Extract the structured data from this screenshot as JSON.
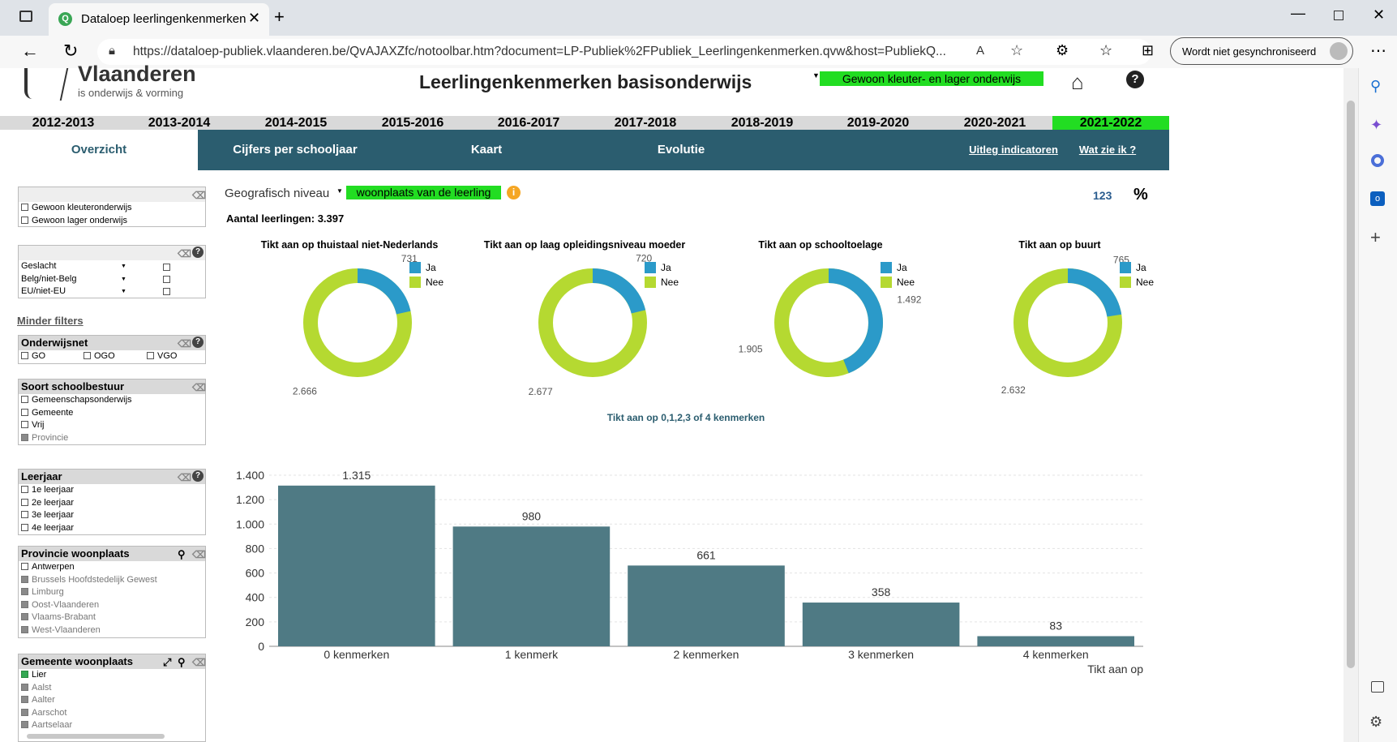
{
  "browser": {
    "tab_title": "Dataloep leerlingenkenmerken",
    "url": "https://dataloep-publiek.vlaanderen.be/QvAJAXZfc/notoolbar.htm?document=LP-Publiek%2FPubliek_Leerlingenkenmerken.qvw&host=PubliekQ...",
    "profile_label": "Wordt niet gesynchroniseerd"
  },
  "logo": {
    "name": "Vlaanderen",
    "tagline": "is onderwijs & vorming"
  },
  "header": {
    "title": "Leerlingenkenmerken basisonderwijs",
    "selector_value": "Gewoon kleuter- en lager onderwijs"
  },
  "years": [
    "2012-2013",
    "2013-2014",
    "2014-2015",
    "2015-2016",
    "2016-2017",
    "2017-2018",
    "2018-2019",
    "2019-2020",
    "2020-2021",
    "2021-2022"
  ],
  "selected_year": "2021-2022",
  "nav": {
    "overview": "Overzicht",
    "per_year": "Cijfers per schooljaar",
    "map": "Kaart",
    "evolution": "Evolutie",
    "explain": "Uitleg indicatoren",
    "what": "Wat zie ik ?"
  },
  "filters": {
    "onderwijs": [
      "Gewoon kleuteronderwijs",
      "Gewoon lager onderwijs"
    ],
    "dropdowns": [
      "Geslacht",
      "Belg/niet-Belg",
      "EU/niet-EU"
    ],
    "fewer_filters": "Minder filters",
    "onderwijsnet": {
      "title": "Onderwijsnet",
      "items": [
        "GO",
        "OGO",
        "VGO"
      ]
    },
    "schoolbestuur": {
      "title": "Soort schoolbestuur",
      "items": [
        "Gemeenschapsonderwijs",
        "Gemeente",
        "Vrij",
        "Provincie"
      ]
    },
    "leerjaar": {
      "title": "Leerjaar",
      "items": [
        "1e leerjaar",
        "2e leerjaar",
        "3e leerjaar",
        "4e leerjaar"
      ]
    },
    "provincie": {
      "title": "Provincie woonplaats",
      "items": [
        "Antwerpen",
        "Brussels Hoofdstedelijk Gewest",
        "Limburg",
        "Oost-Vlaanderen",
        "Vlaams-Brabant",
        "West-Vlaanderen"
      ]
    },
    "gemeente": {
      "title": "Gemeente woonplaats",
      "items": [
        "Lier",
        "Aalst",
        "Aalter",
        "Aarschot",
        "Aartselaar"
      ]
    }
  },
  "main": {
    "geo_label": "Geografisch niveau",
    "geo_value": "woonplaats van de leerling",
    "count_label": "Aantal leerlingen: 3.397",
    "toggle_num": "123",
    "toggle_pct": "%",
    "legend_ja": "Ja",
    "legend_nee": "Nee",
    "bar_title": "Tikt aan op 0,1,2,3 of 4 kenmerken",
    "bar_xlabel": "Tikt aan op"
  },
  "colors": {
    "ja": "#2b9ac9",
    "nee": "#b5d931",
    "bar": "#4f7a84",
    "nav": "#2b5d6f",
    "highlight": "#22dd22"
  },
  "chart_data": [
    {
      "type": "pie",
      "title": "Tikt aan op thuistaal niet-Nederlands",
      "labels": [
        "Ja",
        "Nee"
      ],
      "values": [
        731,
        2666
      ],
      "value_labels": [
        "731",
        "2.666"
      ]
    },
    {
      "type": "pie",
      "title": "Tikt aan op laag opleidingsniveau moeder",
      "labels": [
        "Ja",
        "Nee"
      ],
      "values": [
        720,
        2677
      ],
      "value_labels": [
        "720",
        "2.677"
      ]
    },
    {
      "type": "pie",
      "title": "Tikt aan op schooltoelage",
      "labels": [
        "Ja",
        "Nee"
      ],
      "values": [
        1492,
        1905
      ],
      "value_labels": [
        "1.492",
        "1.905"
      ]
    },
    {
      "type": "pie",
      "title": "Tikt aan op buurt",
      "labels": [
        "Ja",
        "Nee"
      ],
      "values": [
        765,
        2632
      ],
      "value_labels": [
        "765",
        "2.632"
      ]
    },
    {
      "type": "bar",
      "title": "Tikt aan op 0,1,2,3 of 4 kenmerken",
      "categories": [
        "0 kenmerken",
        "1 kenmerk",
        "2 kenmerken",
        "3 kenmerken",
        "4 kenmerken"
      ],
      "values": [
        1315,
        980,
        661,
        358,
        83
      ],
      "value_labels": [
        "1.315",
        "980",
        "661",
        "358",
        "83"
      ],
      "xlabel": "Tikt aan op",
      "ylim": [
        0,
        1400
      ],
      "yticks": [
        0,
        200,
        400,
        600,
        800,
        1000,
        1200,
        1400
      ],
      "ytick_labels": [
        "0",
        "200",
        "400",
        "600",
        "800",
        "1.000",
        "1.200",
        "1.400"
      ],
      "grid": true
    }
  ]
}
